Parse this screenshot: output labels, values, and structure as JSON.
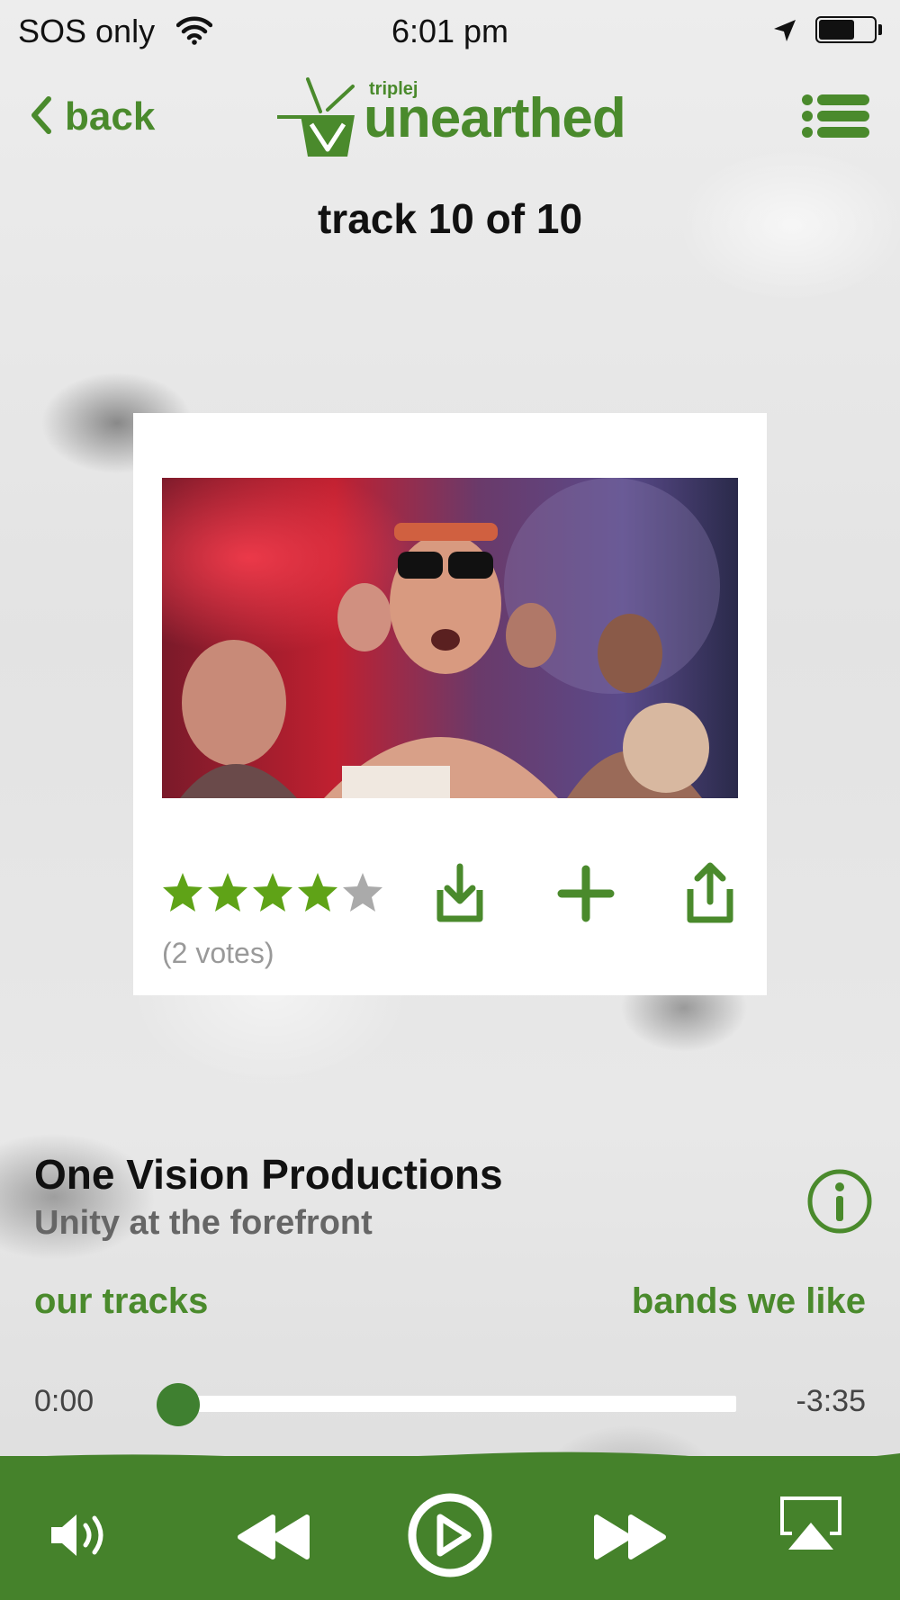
{
  "status": {
    "carrier": "SOS only",
    "time": "6:01 pm",
    "battery_level": 0.65
  },
  "nav": {
    "back_label": "back",
    "logo_small": "triplej",
    "logo_big": "unearthed"
  },
  "track_title": "track 10 of 10",
  "card": {
    "rating": 4,
    "rating_max": 5,
    "votes": "(2 votes)"
  },
  "artist": {
    "name": "One Vision Productions",
    "subtitle": "Unity at the forefront"
  },
  "links": {
    "our_tracks": "our tracks",
    "bands_we_like": "bands we like"
  },
  "progress": {
    "current": "0:00",
    "remaining": "-3:35",
    "fraction": 0
  },
  "colors": {
    "brand_green": "#4a8a2c",
    "player_bar": "#45822b",
    "star_on": "#5fa317",
    "star_off": "#aaaaaa"
  },
  "icons": {
    "back": "chevron-left-icon",
    "menu": "list-icon",
    "download": "download-icon",
    "add": "plus-icon",
    "share": "share-icon",
    "info": "info-icon",
    "volume": "volume-icon",
    "rewind": "rewind-icon",
    "play": "play-icon",
    "forward": "fast-forward-icon",
    "airplay": "airplay-icon"
  }
}
